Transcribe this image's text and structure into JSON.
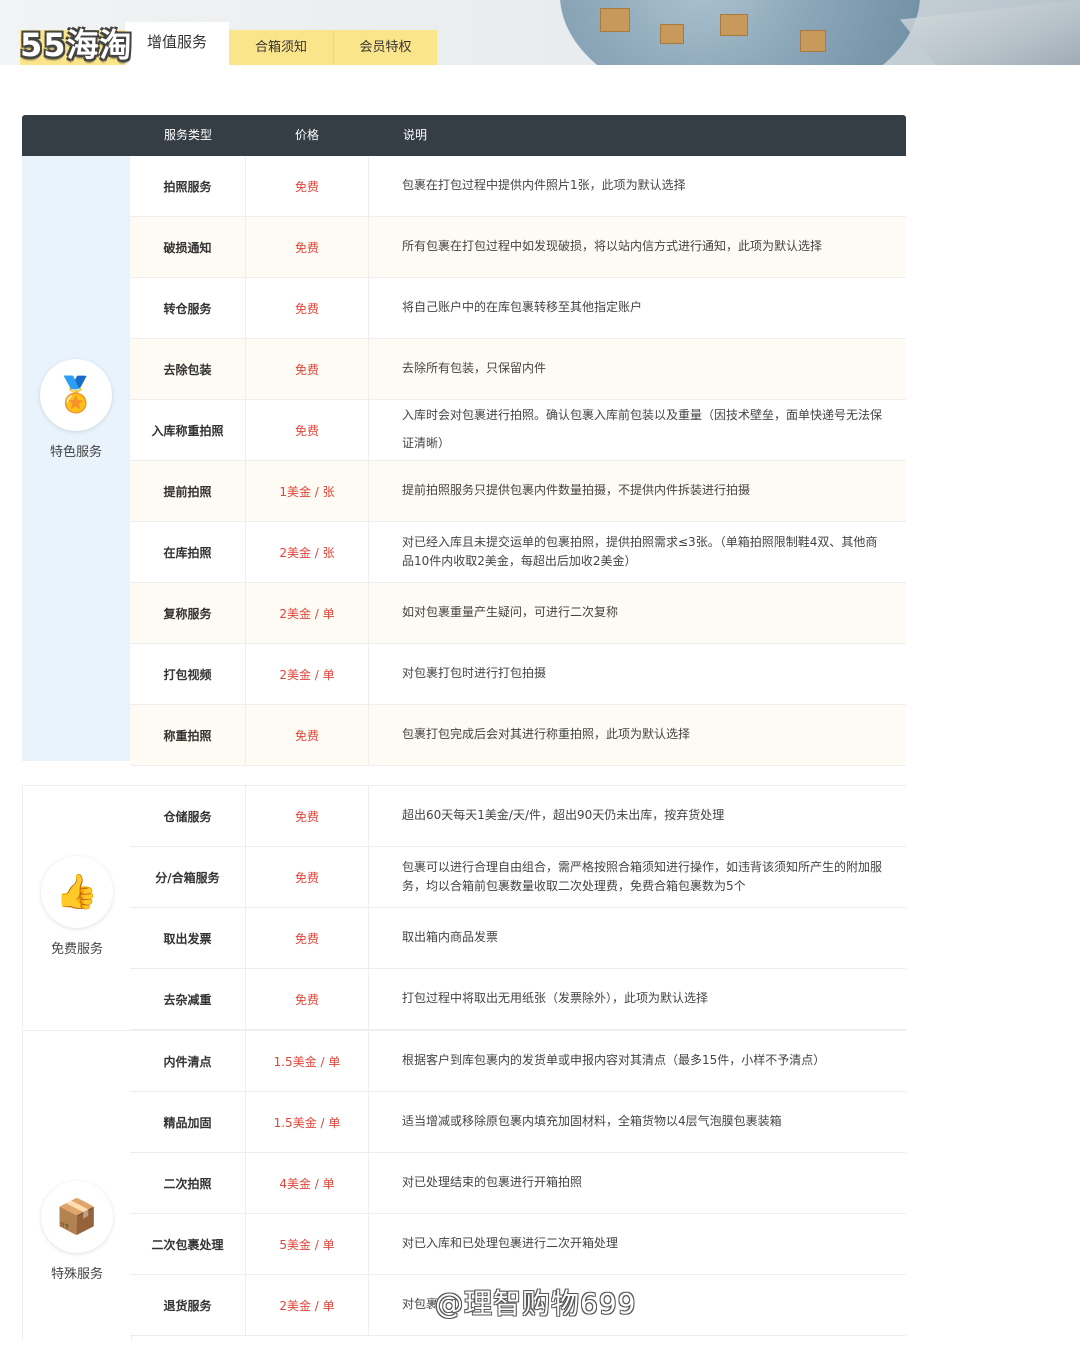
{
  "header": {
    "logo_text": "55海淘",
    "tabs": [
      {
        "label": "增值服务",
        "active": true
      },
      {
        "label": "合箱须知",
        "active": false
      },
      {
        "label": "会员特权",
        "active": false
      }
    ]
  },
  "table": {
    "columns": [
      "服务类型",
      "价格",
      "说明"
    ],
    "groups": [
      {
        "category": "特色服务",
        "icon": "medal-24-icon",
        "rows": [
          {
            "type": "拍照服务",
            "price": "免费",
            "desc": "包裹在打包过程中提供内件照片1张，此项为默认选择"
          },
          {
            "type": "破损通知",
            "price": "免费",
            "desc": "所有包裹在打包过程中如发现破损，将以站内信方式进行通知，此项为默认选择"
          },
          {
            "type": "转仓服务",
            "price": "免费",
            "desc": "将自己账户中的在库包裹转移至其他指定账户"
          },
          {
            "type": "去除包装",
            "price": "免费",
            "desc": "去除所有包装，只保留内件"
          },
          {
            "type": "入库称重拍照",
            "price": "免费",
            "desc": "入库时会对包裹进行拍照。确认包裹入库前包装以及重量（因技术壁垒，面单快递号无法保证清晰）"
          },
          {
            "type": "提前拍照",
            "price": "1美金 / 张",
            "desc": "提前拍照服务只提供包裹内件数量拍摄，不提供内件拆装进行拍摄"
          },
          {
            "type": "在库拍照",
            "price": "2美金 / 张",
            "desc": "对已经入库且未提交运单的包裹拍照，提供拍照需求≤3张。（单箱拍照限制鞋4双、其他商品10件内收取2美金，每超出后加收2美金）"
          },
          {
            "type": "复称服务",
            "price": "2美金 / 单",
            "desc": "如对包裹重量产生疑问，可进行二次复称"
          },
          {
            "type": "打包视频",
            "price": "2美金 / 单",
            "desc": "对包裹打包时进行打包拍摄"
          },
          {
            "type": "称重拍照",
            "price": "免费",
            "desc": "包裹打包完成后会对其进行称重拍照，此项为默认选择"
          }
        ]
      },
      {
        "category": "免费服务",
        "icon": "thumbs-up-stars-icon",
        "rows": [
          {
            "type": "仓储服务",
            "price": "免费",
            "desc": "超出60天每天1美金/天/件，超出90天仍未出库，按弃货处理"
          },
          {
            "type": "分/合箱服务",
            "price": "免费",
            "desc": "包裹可以进行合理自由组合，需严格按照合箱须知进行操作，如违背该须知所产生的附加服务，均以合箱前包裹数量收取二次处理费，免费合箱包裹数为5个"
          },
          {
            "type": "取出发票",
            "price": "免费",
            "desc": "取出箱内商品发票"
          },
          {
            "type": "去杂减重",
            "price": "免费",
            "desc": "打包过程中将取出无用纸张（发票除外），此项为默认选择"
          }
        ]
      },
      {
        "category": "特殊服务",
        "icon": "delivery-worker-icon",
        "rows": [
          {
            "type": "内件清点",
            "price": "1.5美金 / 单",
            "desc": "根据客户到库包裹内的发货单或申报内容对其清点（最多15件，小样不予清点）"
          },
          {
            "type": "精品加固",
            "price": "1.5美金 / 单",
            "desc": "适当增减或移除原包裹内填充加固材料，全箱货物以4层气泡膜包裹装箱"
          },
          {
            "type": "二次拍照",
            "price": "4美金 / 单",
            "desc": "对已处理结束的包裹进行开箱拍照"
          },
          {
            "type": "二次包裹处理",
            "price": "5美金 / 单",
            "desc": "对已入库和已处理包裹进行二次开箱处理"
          },
          {
            "type": "退货服务",
            "price": "2美金 / 单",
            "desc": "对包裹"
          }
        ]
      }
    ]
  },
  "watermark": "@理智购物699"
}
